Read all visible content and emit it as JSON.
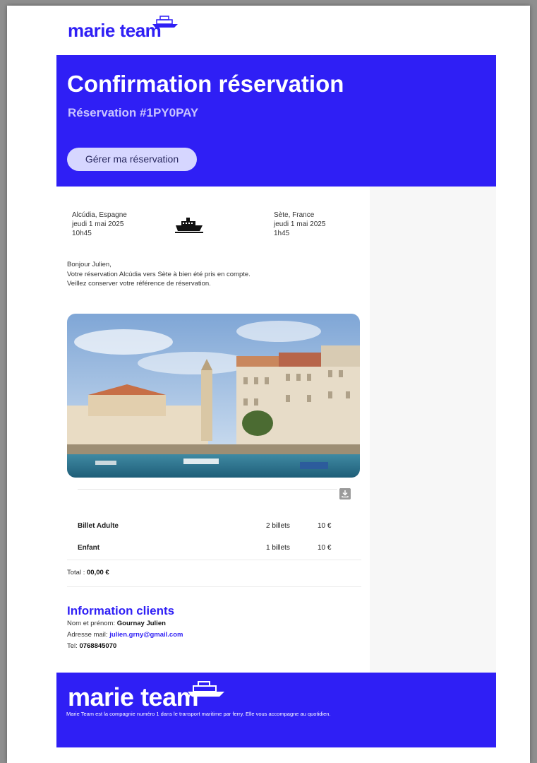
{
  "brand": {
    "name": "marie team",
    "accent": "#2f1ff5"
  },
  "hero": {
    "title": "Confirmation réservation",
    "subtitle": "Réservation #1PY0PAY",
    "manage_button": "Gérer ma réservation"
  },
  "trip": {
    "from": {
      "city": "Alcúdia, Espagne",
      "date": "jeudi 1 mai 2025",
      "time": "10h45"
    },
    "to": {
      "city": "Sète, France",
      "date": "jeudi 1 mai 2025",
      "time": "1h45"
    },
    "icon": "ferry-icon"
  },
  "greeting": {
    "line1": "Bonjour Julien,",
    "line2": "Votre réservation Alcúdia vers Sète à bien été pris en compte.",
    "line3": "Veillez conserver votre référence de réservation."
  },
  "tickets": [
    {
      "name": "Billet Adulte",
      "qty": "2 billets",
      "price": "10 €"
    },
    {
      "name": "Enfant",
      "qty": "1 billets",
      "price": "10 €"
    }
  ],
  "total": {
    "label": "Total : ",
    "value": "00,00 €"
  },
  "client": {
    "title": "Information clients",
    "name_label": "Nom et prénom: ",
    "name_value": "Gournay Julien",
    "email_label": "Adresse mail: ",
    "email_value": "julien.grny@gmail.com",
    "tel_label": "Tel: ",
    "tel_value": "0768845070"
  },
  "footer": {
    "tagline": "Marie Team est la compagnie numéro 1 dans le transport maritime par ferry. Elle vous accompagne au quotidien."
  }
}
